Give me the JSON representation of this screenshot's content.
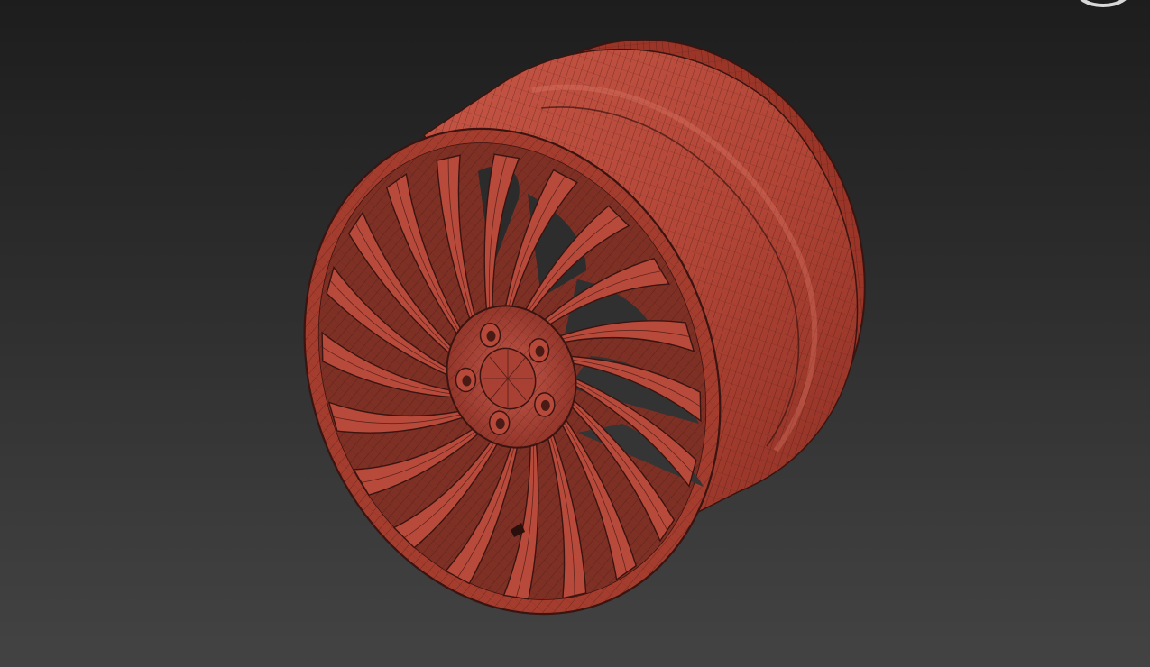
{
  "viewport": {
    "background_top": "#1d1d1d",
    "background_bottom": "#434343"
  },
  "model": {
    "object": "wheel-rim",
    "display": "wireframe-on-shaded",
    "material_color": "#b84a3b",
    "wire_color": "#3a1410",
    "spoke_count": 20,
    "lug_nut_count": 5
  },
  "viewcube": {
    "icon": "viewcube-ring-icon",
    "color": "#d8d8d8"
  }
}
